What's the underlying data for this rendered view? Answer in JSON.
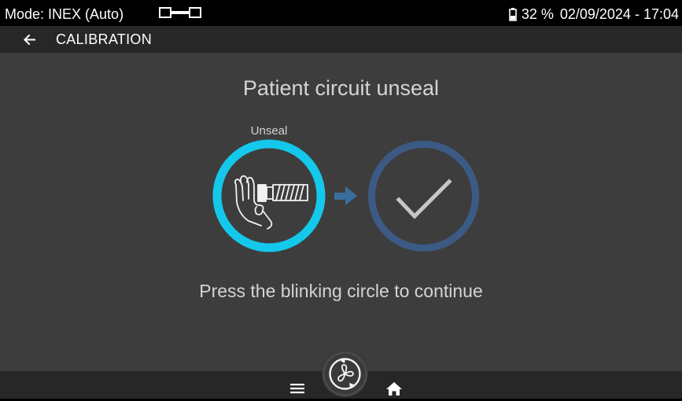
{
  "status_bar": {
    "mode": "Mode: INEX (Auto)",
    "mode_glyph_icon": "mode-indicator-icon",
    "battery_icon": "battery-icon",
    "battery": "32 %",
    "datetime": "02/09/2024 - 17:04"
  },
  "header": {
    "back_icon": "arrow-left-icon",
    "title": "CALIBRATION"
  },
  "main": {
    "title": "Patient circuit unseal",
    "steps": [
      {
        "label": "Unseal",
        "icon": "hand-covering-circuit-icon",
        "state": "active"
      },
      {
        "label": "",
        "icon": "checkmark-icon",
        "state": "pending"
      }
    ],
    "arrow_icon": "arrow-right-icon",
    "instruction": "Press the blinking circle to continue"
  },
  "bottom_nav": {
    "menu_icon": "menu-icon",
    "fan_icon": "fan-icon",
    "home_icon": "home-icon"
  },
  "colors": {
    "active_ring": "#14c8ec",
    "pending_ring": "#3b5b85",
    "content_bg": "#3d3d3d",
    "bar_bg": "#272727"
  }
}
